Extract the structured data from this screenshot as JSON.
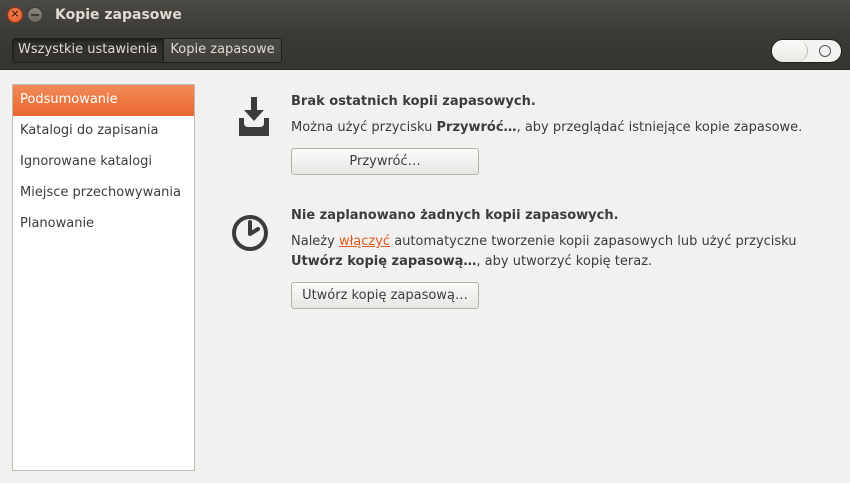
{
  "window": {
    "title": "Kopie zapasowe"
  },
  "toolbar": {
    "breadcrumb_all": "Wszystkie ustawienia",
    "breadcrumb_current": "Kopie zapasowe"
  },
  "sidebar": {
    "items": [
      {
        "label": "Podsumowanie",
        "selected": true
      },
      {
        "label": "Katalogi do zapisania",
        "selected": false
      },
      {
        "label": "Ignorowane katalogi",
        "selected": false
      },
      {
        "label": "Miejsce przechowywania",
        "selected": false
      },
      {
        "label": "Planowanie",
        "selected": false
      }
    ]
  },
  "summary": {
    "restore": {
      "icon": "download-tray-icon",
      "heading": "Brak ostatnich kopii zapasowych.",
      "text_pre": "Można użyć przycisku ",
      "text_bold": "Przywróć…",
      "text_post": ", aby przeglądać istniejące kopie zapasowe.",
      "button_label": "Przywróć…"
    },
    "schedule": {
      "icon": "clock-icon",
      "heading": "Nie zaplanowano żadnych kopii zapasowych.",
      "text_pre": "Należy ",
      "link": "włączyć",
      "text_mid": " automatyczne tworzenie kopii zapasowych lub użyć przycisku ",
      "text_bold": "Utwórz kopię zapasową…",
      "text_post": ", aby utworzyć kopię teraz.",
      "button_label": "Utwórz kopię zapasową…"
    }
  },
  "colors": {
    "accent": "#e8682f",
    "link": "#e05a20",
    "titlebar": "#3d3c38"
  }
}
